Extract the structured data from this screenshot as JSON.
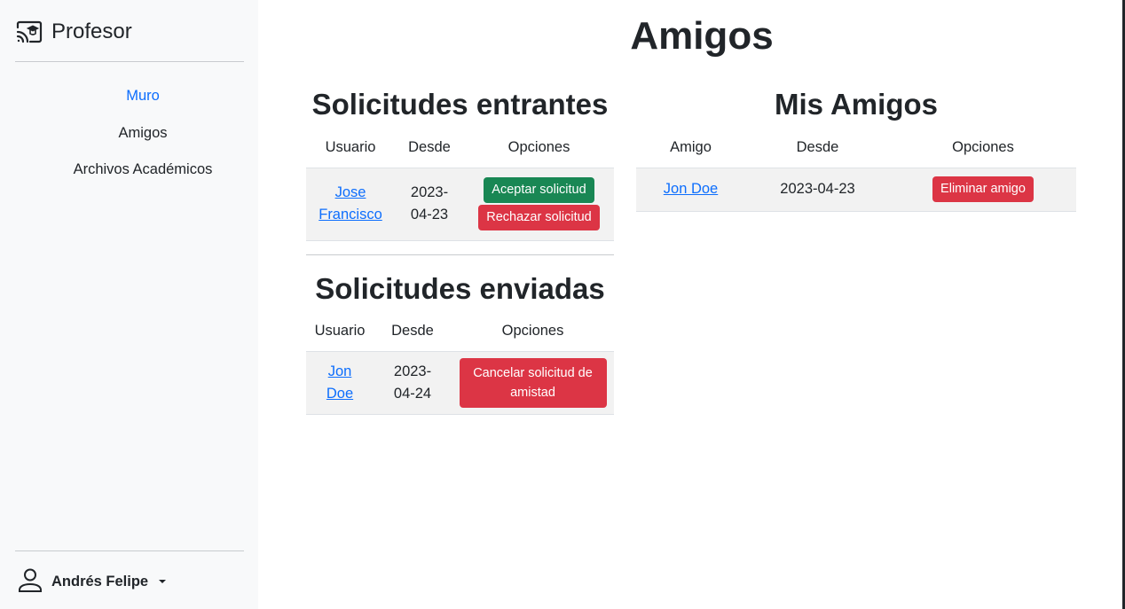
{
  "sidebar": {
    "brand": "Profesor",
    "brand_icon": "cast-icon",
    "nav": [
      {
        "label": "Muro",
        "active": true
      },
      {
        "label": "Amigos",
        "active": false
      },
      {
        "label": "Archivos Académicos",
        "active": false
      }
    ],
    "user": {
      "name": "Andrés Felipe",
      "icon": "person-icon"
    }
  },
  "main": {
    "title": "Amigos",
    "incoming": {
      "title": "Solicitudes entrantes",
      "columns": [
        "Usuario",
        "Desde",
        "Opciones"
      ],
      "rows": [
        {
          "user": "Jose Francisco",
          "since": "2023-04-23",
          "accept_label": "Aceptar solicitud",
          "reject_label": "Rechazar solicitud"
        }
      ]
    },
    "sent": {
      "title": "Solicitudes enviadas",
      "columns": [
        "Usuario",
        "Desde",
        "Opciones"
      ],
      "rows": [
        {
          "user": "Jon Doe",
          "since": "2023-04-24",
          "cancel_label": "Cancelar solicitud de amistad"
        }
      ]
    },
    "friends": {
      "title": "Mis Amigos",
      "columns": [
        "Amigo",
        "Desde",
        "Opciones"
      ],
      "rows": [
        {
          "friend": "Jon Doe",
          "since": "2023-04-23",
          "remove_label": "Eliminar amigo"
        }
      ]
    }
  },
  "colors": {
    "link": "#0d6efd",
    "success": "#198754",
    "danger": "#dc3545",
    "sidebar_bg": "#f8f9fa"
  }
}
